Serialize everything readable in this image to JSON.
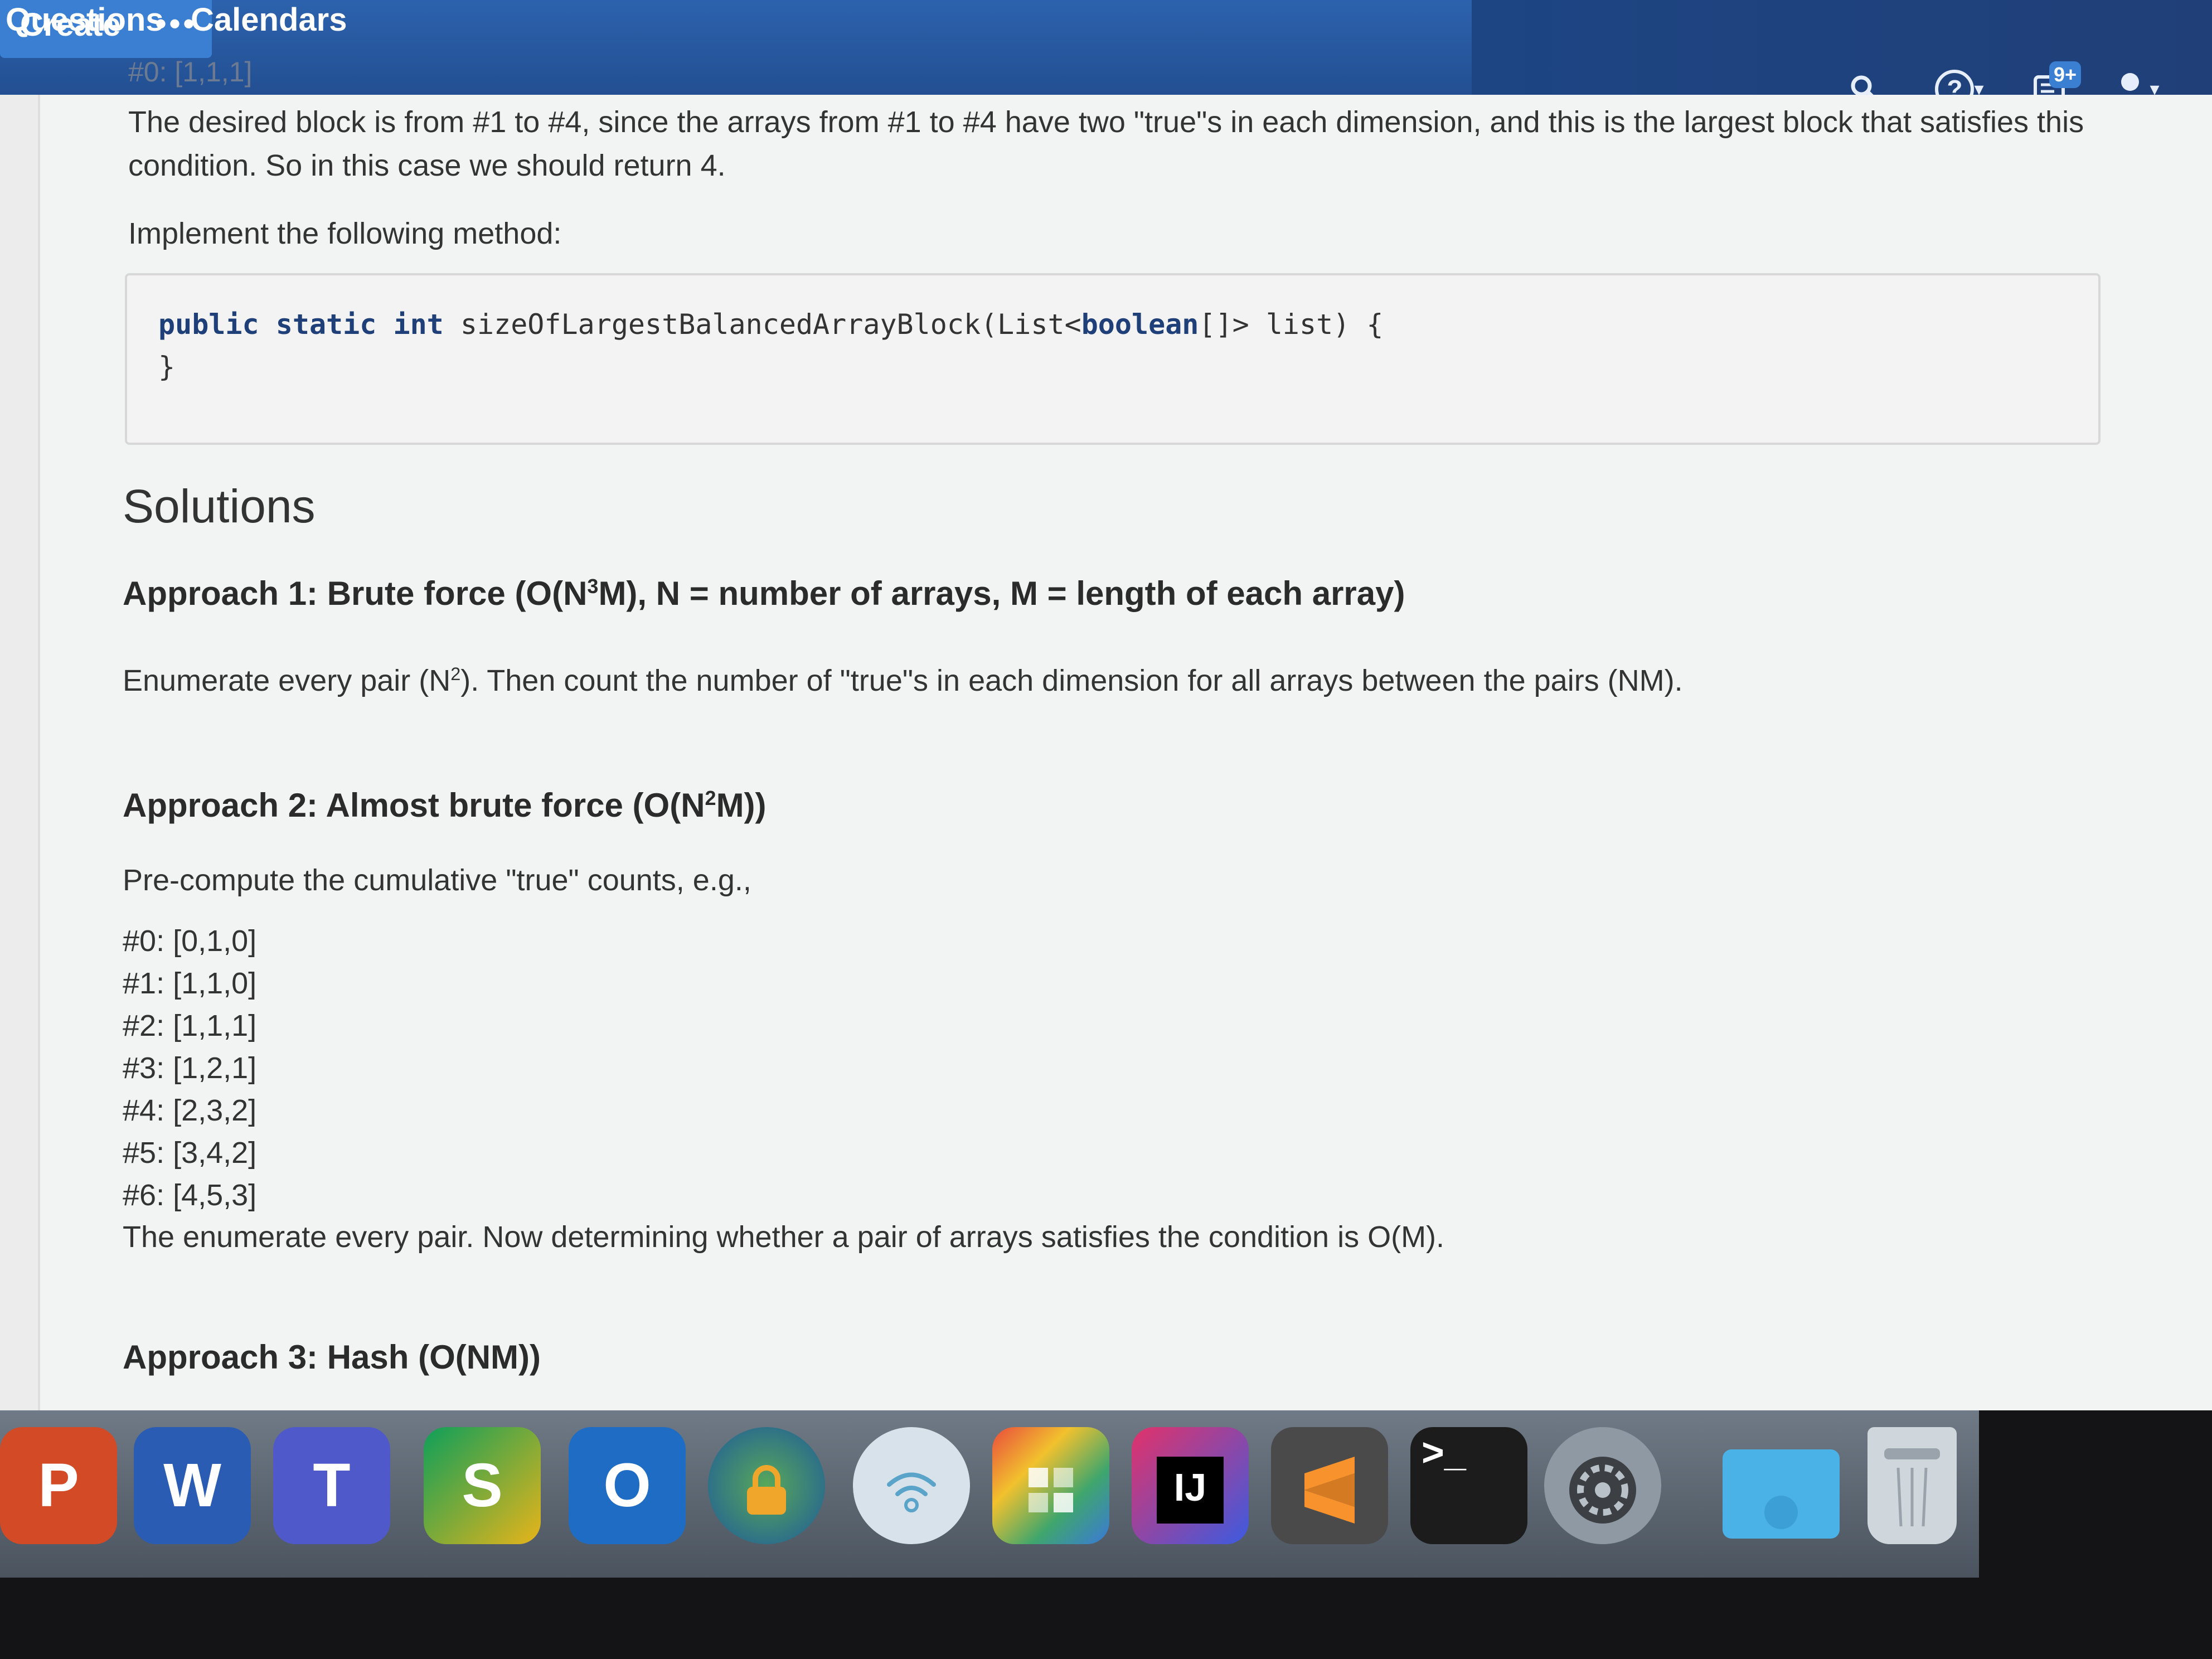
{
  "nav": {
    "questions": "Questions",
    "calendars": "Calendars",
    "create": "Create",
    "more": "•••",
    "notification_badge": "9+",
    "icons": [
      "search-icon",
      "help-icon",
      "notification-icon",
      "user-icon"
    ]
  },
  "content": {
    "cut_line": "#0: [1,1,1]",
    "desired_text": "The desired block is from #1 to #4, since the arrays from #1 to #4 have two \"true\"s in each dimension, and this is the largest block that satisfies this condition. So in this case we should return 4.",
    "implement_text": "Implement the following method:",
    "code": {
      "kw1": "public",
      "kw2": "static",
      "kw3": "int",
      "signature_a": "sizeOfLargestBalancedArrayBlock(List<",
      "kw4": "boolean",
      "signature_b": "[]> list) {",
      "closing": "}"
    },
    "solutions_heading": "Solutions",
    "approach1": {
      "title_a": "Approach 1: Brute force (O(N",
      "title_sup": "3",
      "title_b": "M), N = number of arrays, M = length of each array)",
      "desc_a": "Enumerate every pair (N",
      "desc_sup": "2",
      "desc_b": "). Then count the number of \"true\"s in each dimension for all arrays between the pairs (NM)."
    },
    "approach2": {
      "title_a": "Approach 2: Almost brute force (O(N",
      "title_sup": "2",
      "title_b": "M))",
      "desc": "Pre-compute the cumulative \"true\" counts, e.g.,",
      "counts": [
        "#0: [0,1,0]",
        "#1: [1,1,0]",
        "#2: [1,1,1]",
        "#3: [1,2,1]",
        "#4: [2,3,2]",
        "#5: [3,4,2]",
        "#6: [4,5,3]"
      ],
      "after": "The enumerate every pair. Now determining whether a pair of arrays satisfies the condition is O(M)."
    },
    "approach3": {
      "title": "Approach 3: Hash (O(NM))"
    }
  },
  "dock": {
    "ppt": "P",
    "word": "W",
    "teams": "T",
    "skype": "S",
    "outlook": "O",
    "intellij": "IJ",
    "terminal": ">_",
    "icons": [
      "powerpoint-icon",
      "word-icon",
      "teams-icon",
      "skype-icon",
      "outlook-icon",
      "vpn-icon",
      "wifi-icon",
      "pixel-app-icon",
      "intellij-icon",
      "sublime-icon",
      "terminal-icon",
      "system-preferences-icon",
      "folder-icon",
      "trash-icon"
    ]
  }
}
